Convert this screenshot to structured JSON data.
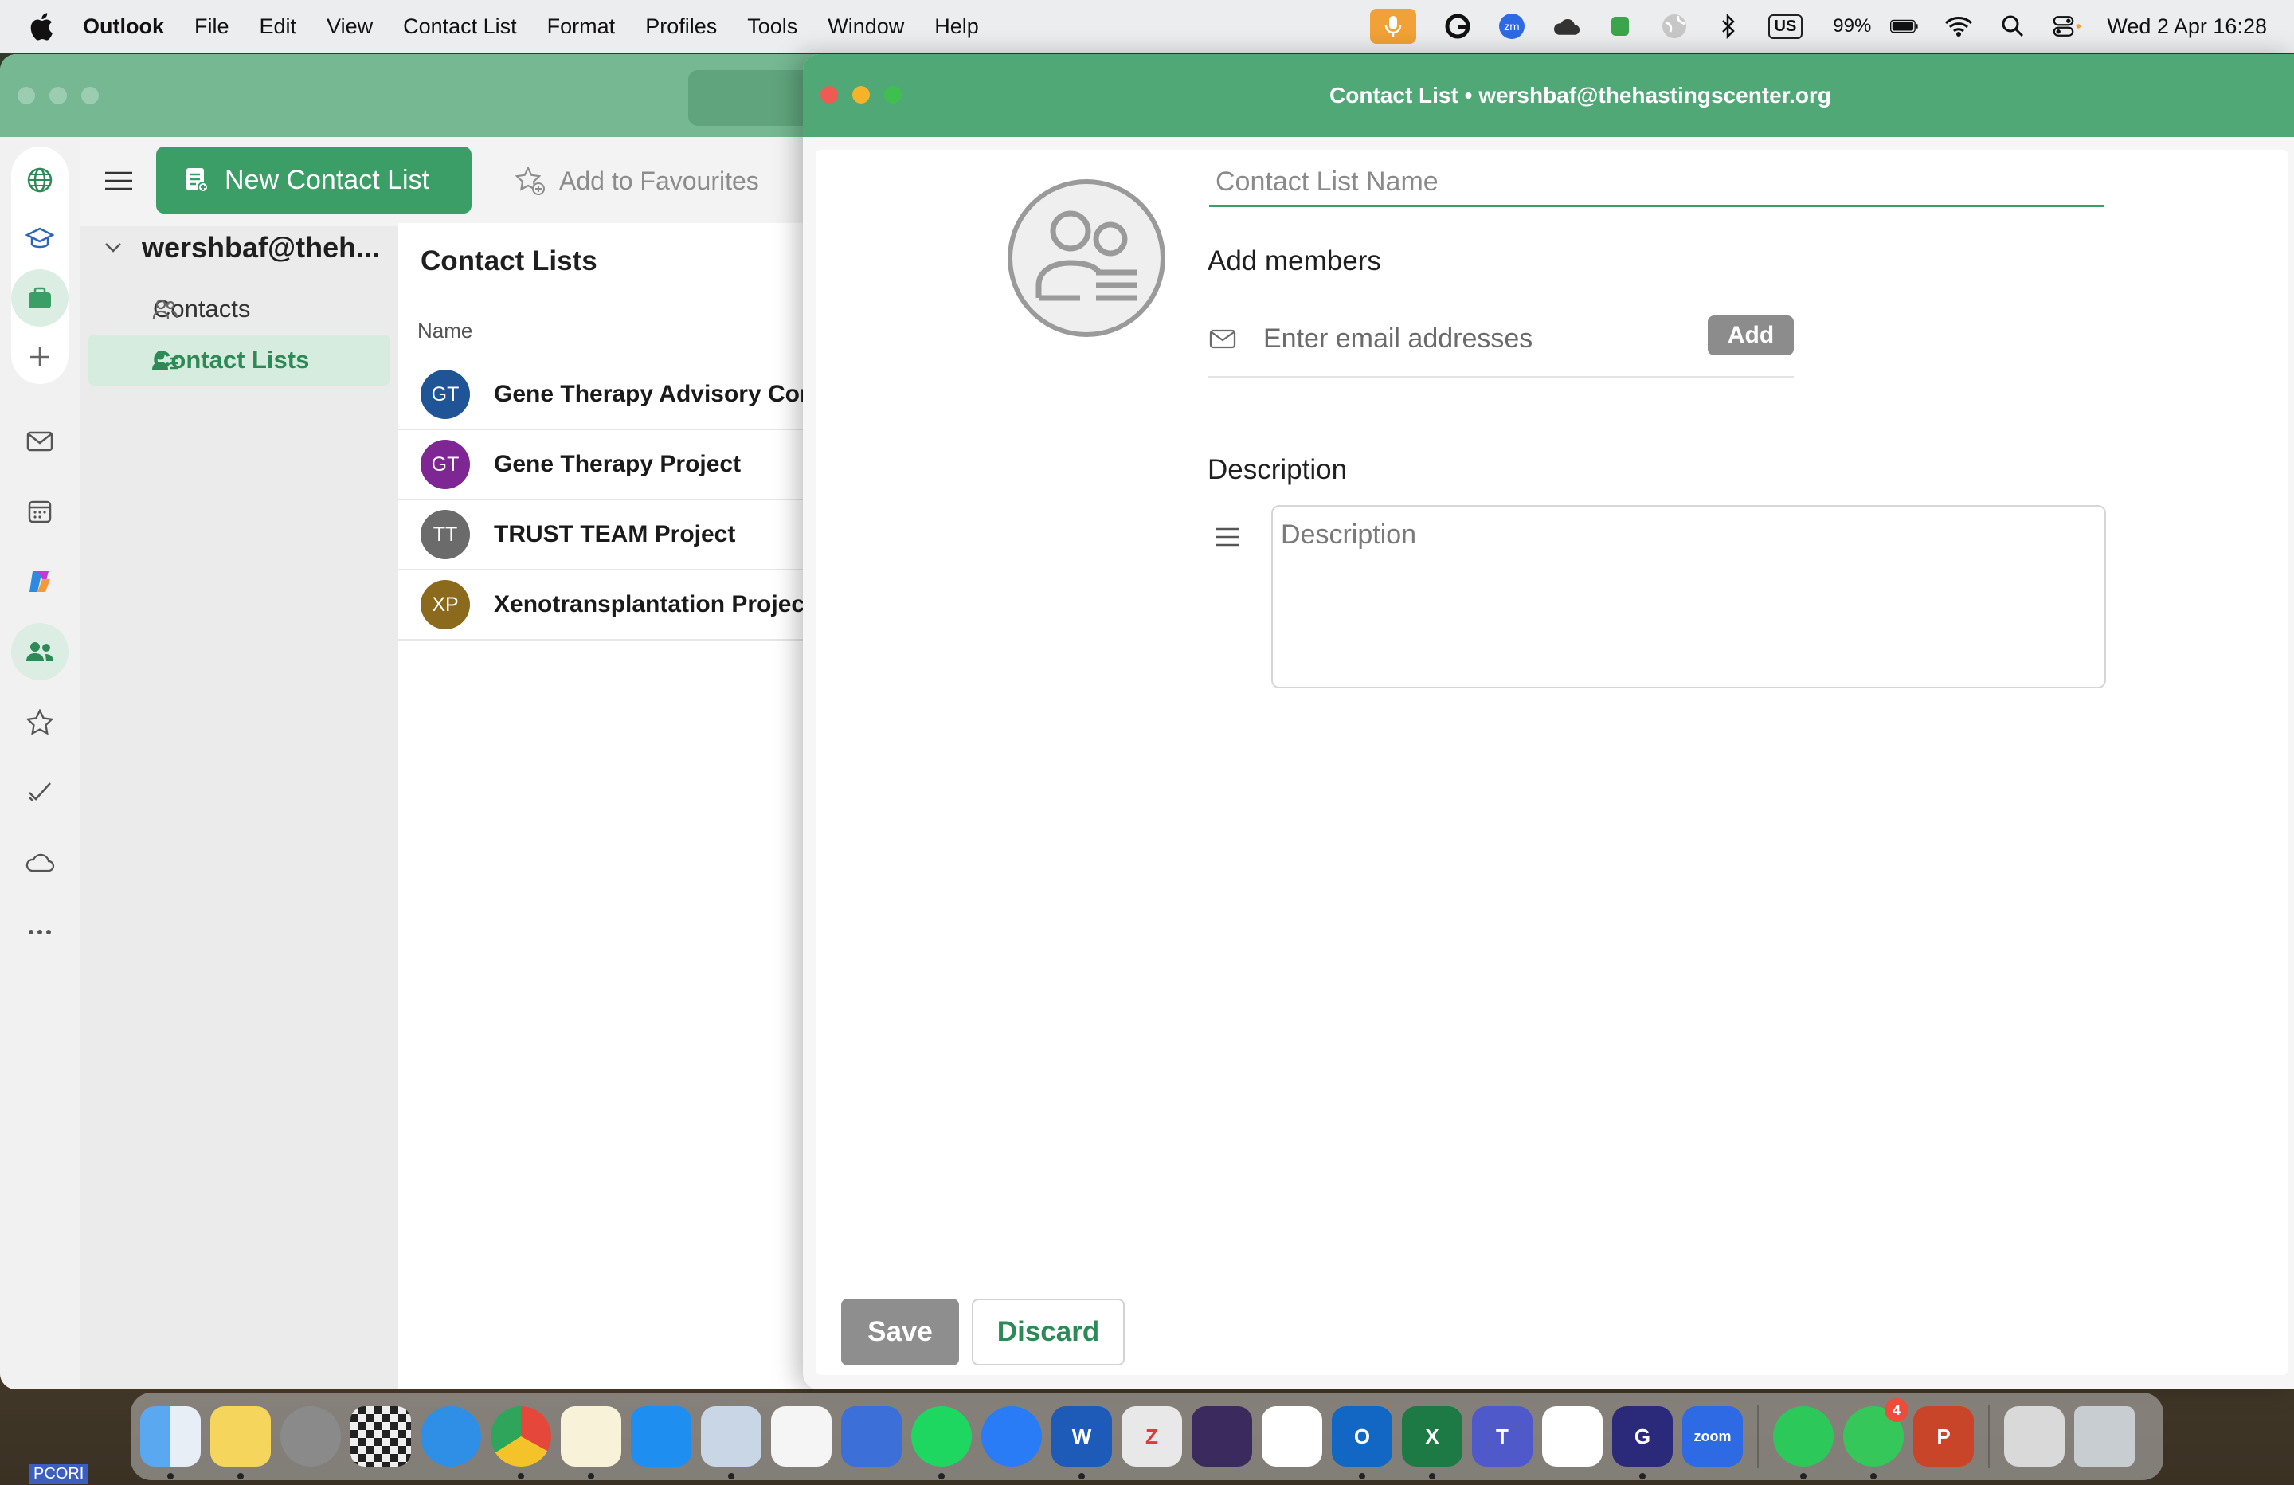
{
  "menubar": {
    "app_name": "Outlook",
    "items": [
      "File",
      "Edit",
      "View",
      "Contact List",
      "Format",
      "Profiles",
      "Tools",
      "Window",
      "Help"
    ],
    "battery": "99%",
    "keyboard": "US",
    "clock": "Wed 2 Apr  16:28"
  },
  "main": {
    "toolbar": {
      "new_contact_list": "New Contact List",
      "add_to_favourites": "Add to Favourites"
    },
    "account": "wershbaf@theh...",
    "folders": [
      {
        "label": "Contacts"
      },
      {
        "label": "Contact Lists"
      }
    ],
    "list": {
      "title": "Contact Lists",
      "column_name": "Name",
      "rows": [
        {
          "initials": "GT",
          "name": "Gene Therapy Advisory Comm",
          "color": "#1f5596"
        },
        {
          "initials": "GT",
          "name": "Gene Therapy Project",
          "color": "#7e2694"
        },
        {
          "initials": "TT",
          "name": "TRUST TEAM Project",
          "color": "#6b6b6b"
        },
        {
          "initials": "XP",
          "name": "Xenotransplantation Project",
          "color": "#8b6a1e"
        }
      ]
    }
  },
  "contact_list_window": {
    "title": "Contact List • wershbaf@thehastingscenter.org",
    "name_placeholder": "Contact List Name",
    "add_members_label": "Add members",
    "email_placeholder": "Enter email addresses",
    "add_button": "Add",
    "description_label": "Description",
    "description_placeholder": "Description",
    "save_button": "Save",
    "discard_button": "Discard"
  },
  "dock": {
    "messages_badge": "4",
    "zoom_label": "zoom"
  },
  "desktop": {
    "pcori_label": "PCORI"
  },
  "colors": {
    "accent": "#3a9e66",
    "titlebar": "#4fa876"
  }
}
